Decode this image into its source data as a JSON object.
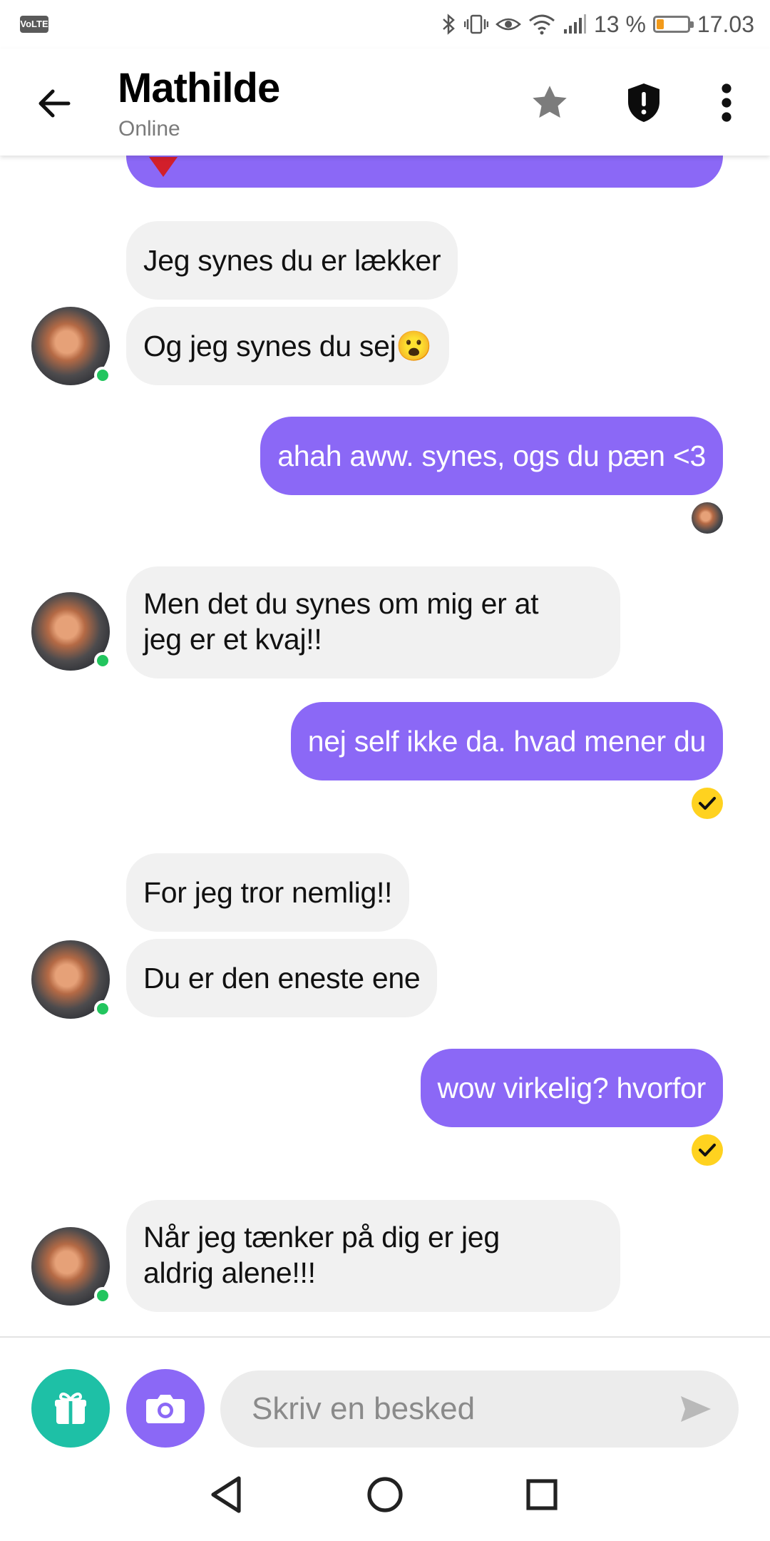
{
  "status_bar": {
    "volte": "VoLTE",
    "battery_percent": "13 %",
    "battery_level": 0.13,
    "time": "17.03"
  },
  "header": {
    "name": "Mathilde",
    "status": "Online",
    "icons": [
      "back-arrow-icon",
      "star-icon",
      "shield-icon",
      "more-vert-icon"
    ]
  },
  "messages": [
    {
      "side": "in",
      "text": "Jeg synes du er lækker"
    },
    {
      "side": "in",
      "text": "Og jeg synes du sej😮"
    },
    {
      "side": "out",
      "text": "ahah aww. synes, ogs du pæn <3"
    },
    {
      "side": "in",
      "text": "Men det du synes om mig er at\njeg er et kvaj!!"
    },
    {
      "side": "out",
      "text": "nej self ikke da. hvad mener du"
    },
    {
      "side": "in",
      "text": "For jeg tror nemlig!!"
    },
    {
      "side": "in",
      "text": "Du er den eneste ene"
    },
    {
      "side": "out",
      "text": "wow virkelig? hvorfor"
    },
    {
      "side": "in",
      "text": "Når jeg tænker på dig er jeg\naldrig alene!!!"
    }
  ],
  "input": {
    "placeholder": "Skriv en besked"
  },
  "colors": {
    "outgoing": "#8b68f6",
    "incoming": "#f1f1f1",
    "gift": "#1ec0a6",
    "camera": "#8b68f6",
    "online": "#22c55e",
    "read_check": "#ffd21f"
  }
}
